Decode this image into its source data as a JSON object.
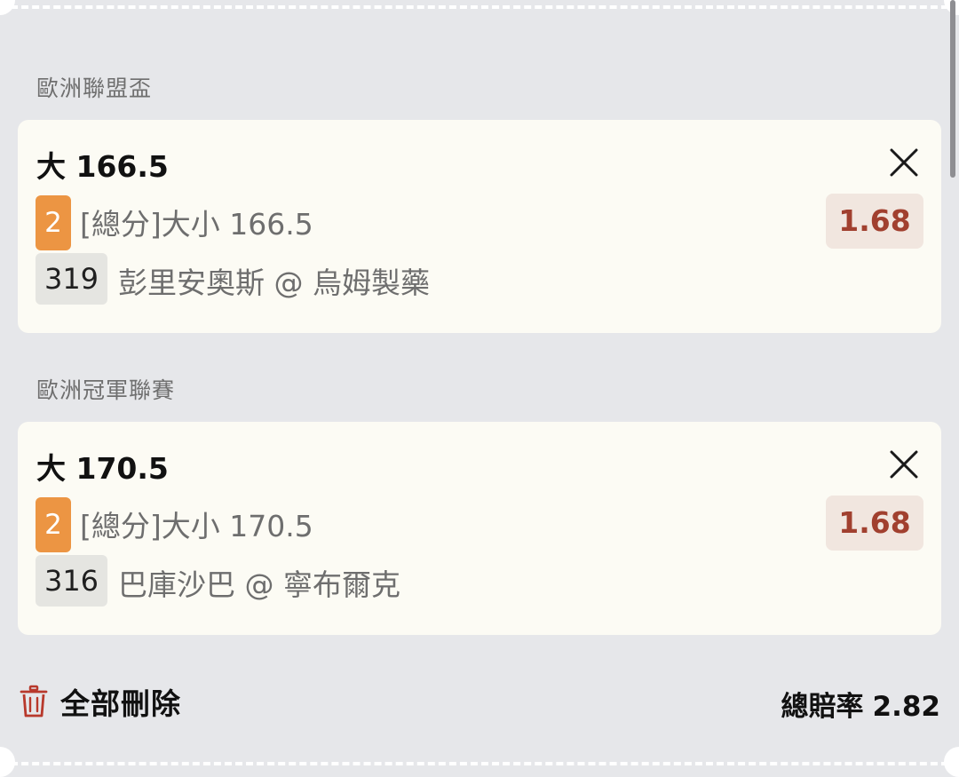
{
  "bets": [
    {
      "league": "歐洲聯盟盃",
      "title": "大 166.5",
      "badge": "2",
      "market": "[總分]大小 166.5",
      "odds": "1.68",
      "code": "319",
      "matchup": "彭里安奧斯 @ 烏姆製藥"
    },
    {
      "league": "歐洲冠軍聯賽",
      "title": "大 170.5",
      "badge": "2",
      "market": "[總分]大小 170.5",
      "odds": "1.68",
      "code": "316",
      "matchup": "巴庫沙巴 @ 寧布爾克"
    }
  ],
  "footer": {
    "delete_all_label": "全部刪除",
    "total_odds_label": "總賠率",
    "total_odds_value": "2.82"
  },
  "icons": {
    "close": "close-icon",
    "trash": "trash-icon"
  },
  "colors": {
    "badge_bg": "#ec9543",
    "odds_text": "#a1402f",
    "odds_bg": "#f1e6df",
    "trash": "#b8392c"
  }
}
